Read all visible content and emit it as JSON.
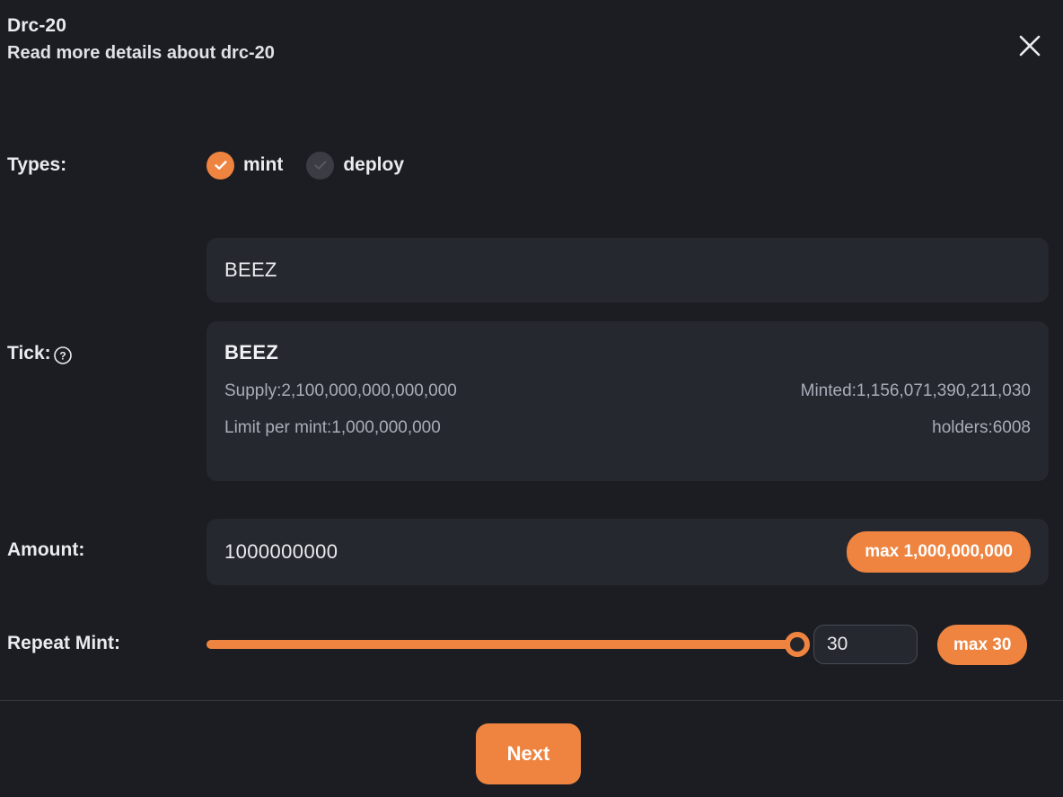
{
  "header": {
    "title": "Drc-20",
    "subtitle": "Read more details about drc-20",
    "close_icon": "close-icon"
  },
  "types": {
    "label": "Types:",
    "options": [
      {
        "label": "mint",
        "selected": true,
        "icon": "check-circle-icon"
      },
      {
        "label": "deploy",
        "selected": false,
        "icon": "check-circle-icon"
      }
    ]
  },
  "tick": {
    "label": "Tick:",
    "help_icon": "question-mark-circle-icon",
    "search_value": "BEEZ",
    "search_placeholder": "",
    "card": {
      "name": "BEEZ",
      "supply": "Supply:2,100,000,000,000,000",
      "minted": "Minted:1,156,071,390,211,030",
      "limit_per_mint": "Limit per mint:1,000,000,000",
      "holders": "holders:6008"
    }
  },
  "amount": {
    "label": "Amount:",
    "value": "1000000000",
    "placeholder": "",
    "max_button": "max 1,000,000,000"
  },
  "repeat_mint": {
    "label": "Repeat Mint:",
    "value": "30",
    "placeholder": "",
    "max_button": "max 30",
    "slider_percent": 100,
    "slider_min": 1,
    "slider_max": 30
  },
  "footer": {
    "next_label": "Next"
  },
  "colors": {
    "background": "#1b1d22",
    "panel": "#26282f",
    "accent": "#ee8440",
    "text": "#e9ebef",
    "muted_text": "#a9adb8",
    "checkbox_off": "#3b3d45",
    "divider": "#33363e"
  }
}
